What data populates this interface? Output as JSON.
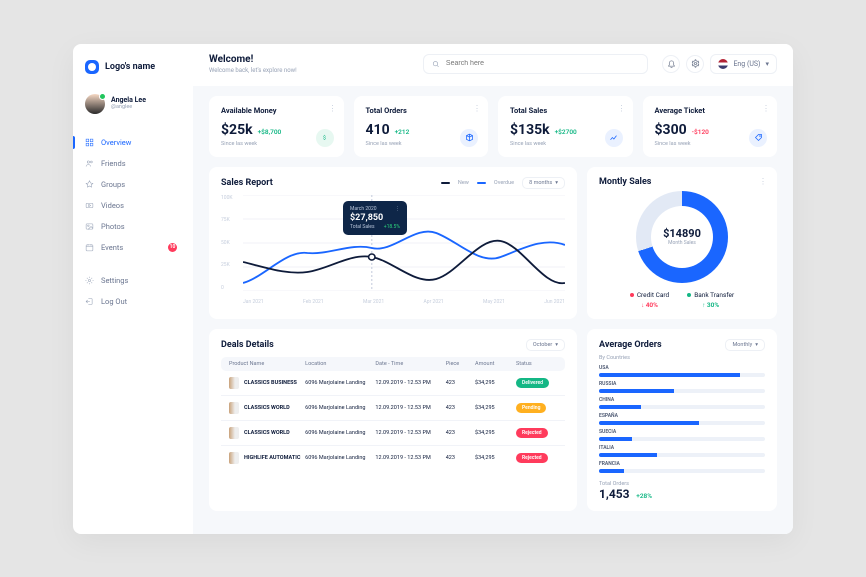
{
  "brand": "Logo's name",
  "user": {
    "name": "Angela Lee",
    "handle": "@anglee"
  },
  "nav": {
    "overview": "Overview",
    "friends": "Friends",
    "groups": "Groups",
    "videos": "Videos",
    "photos": "Photos",
    "events": "Events",
    "events_badge": "10",
    "settings": "Settings",
    "logout": "Log Out"
  },
  "welcome": {
    "title": "Welcome!",
    "subtitle": "Welcome back, let's explore now!"
  },
  "search": {
    "placeholder": "Search here"
  },
  "lang": "Eng (US)",
  "stats": [
    {
      "label": "Available Money",
      "value": "$25k",
      "delta": "+$8,700",
      "dir": "up",
      "sub": "Since las week"
    },
    {
      "label": "Total Orders",
      "value": "410",
      "delta": "+212",
      "dir": "up",
      "sub": "Since las week"
    },
    {
      "label": "Total Sales",
      "value": "$135k",
      "delta": "+$2700",
      "dir": "up",
      "sub": "Since las week"
    },
    {
      "label": "Average Ticket",
      "value": "$300",
      "delta": "-$120",
      "dir": "down",
      "sub": "Since las week"
    }
  ],
  "sales_report": {
    "title": "Sales Report",
    "legend": {
      "new": "New",
      "overdue": "Overdue"
    },
    "period": "8 months",
    "tooltip": {
      "month": "March 2020",
      "value": "$27,850",
      "metric": "Total Sales",
      "change": "+18.5%"
    }
  },
  "chart_data": {
    "type": "line",
    "x": [
      "Jan 2021",
      "Feb 2021",
      "Mar 2021",
      "Apr 2021",
      "May 2021",
      "Jun 2021"
    ],
    "ylim": [
      0,
      100
    ],
    "yticks": [
      "100K",
      "75K",
      "50K",
      "25K",
      "0"
    ],
    "series": [
      {
        "name": "New",
        "color": "#0e1b3a",
        "values": [
          30,
          20,
          35,
          12,
          52,
          8
        ]
      },
      {
        "name": "Overdue",
        "color": "#1a66ff",
        "values": [
          8,
          40,
          45,
          60,
          35,
          48
        ]
      }
    ]
  },
  "monthly": {
    "title": "Montly Sales",
    "value": "$14890",
    "label": "Month Sales",
    "items": [
      {
        "name": "Credit Card",
        "value": "40%",
        "arrow": "↓",
        "dir": "down",
        "dot": "#ff3b5c"
      },
      {
        "name": "Bank Transfer",
        "value": "30%",
        "arrow": "↑",
        "dir": "up",
        "dot": "#14b785"
      }
    ]
  },
  "deals": {
    "title": "Deals Details",
    "period": "October",
    "columns": {
      "name": "Product Name",
      "location": "Location",
      "date": "Date - Time",
      "piece": "Piece",
      "amount": "Amount",
      "status": "Status"
    },
    "rows": [
      {
        "name": "CLASSICS BUSINESS",
        "location": "6096 Marjolaine Landing",
        "date": "12.09.2019 - 12.53 PM",
        "piece": "423",
        "amount": "$34,295",
        "status": "Delivered",
        "status_class": "delivered"
      },
      {
        "name": "CLASSICS WORLD",
        "location": "6096 Marjolaine Landing",
        "date": "12.09.2019 - 12.53 PM",
        "piece": "423",
        "amount": "$34,295",
        "status": "Pending",
        "status_class": "pending"
      },
      {
        "name": "CLASSICS WORLD",
        "location": "6096 Marjolaine Landing",
        "date": "12.09.2019 - 12.53 PM",
        "piece": "423",
        "amount": "$34,295",
        "status": "Rejected",
        "status_class": "rejected"
      },
      {
        "name": "HIGHLIFE AUTOMATIC",
        "location": "6096 Marjolaine Landing",
        "date": "12.09.2019 - 12.53 PM",
        "piece": "423",
        "amount": "$34,295",
        "status": "Rejected",
        "status_class": "rejected"
      }
    ]
  },
  "avg": {
    "title": "Average Orders",
    "period": "Monthly",
    "by": "By Countries",
    "countries": [
      {
        "name": "USA",
        "pct": 85
      },
      {
        "name": "RUSSIA",
        "pct": 45
      },
      {
        "name": "CHINA",
        "pct": 25
      },
      {
        "name": "ESPAÑA",
        "pct": 60
      },
      {
        "name": "SUECIA",
        "pct": 20
      },
      {
        "name": "ITALIA",
        "pct": 35
      },
      {
        "name": "FRANCIA",
        "pct": 15
      }
    ],
    "total_label": "Total Orders",
    "total_value": "1,453",
    "total_change": "+28%"
  }
}
